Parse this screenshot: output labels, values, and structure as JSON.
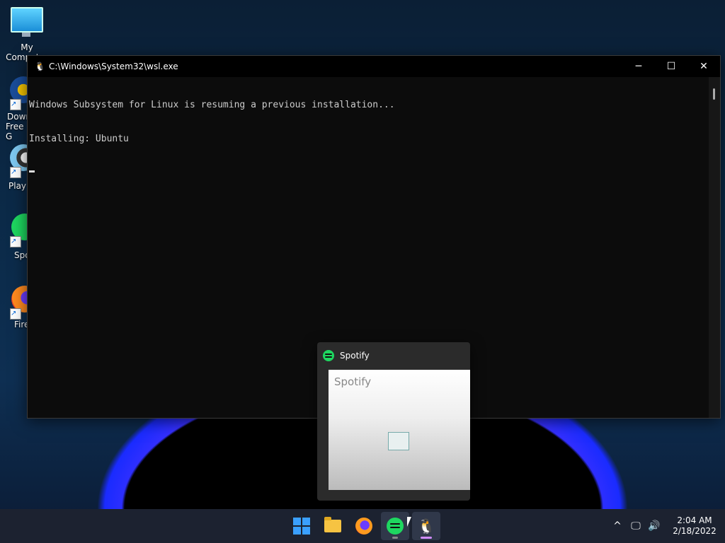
{
  "desktop": {
    "icons": [
      {
        "label": "My Computer",
        "icon": "my-computer-icon"
      },
      {
        "label": "Dowr",
        "label2": "Free G",
        "icon": "download-icon"
      },
      {
        "label": "Play",
        "icon": "player-icon"
      },
      {
        "label": "Spo",
        "icon": "spotify-icon"
      },
      {
        "label": "Fire",
        "icon": "firefox-icon"
      }
    ]
  },
  "window": {
    "title": "C:\\Windows\\System32\\wsl.exe",
    "controls": {
      "minimize": "─",
      "maximize": "☐",
      "close": "✕"
    },
    "console_lines": [
      "Windows Subsystem for Linux is resuming a previous installation...",
      "Installing: Ubuntu"
    ]
  },
  "preview": {
    "app_name": "Spotify",
    "thumbnail_title": "Spotify"
  },
  "taskbar": {
    "apps": [
      "start-button",
      "file-explorer",
      "firefox",
      "spotify",
      "wsl"
    ],
    "tray": {
      "chevron": "^",
      "network": "🖵",
      "volume": "🔊"
    },
    "clock": {
      "time": "2:04 AM",
      "date": "2/18/2022"
    }
  },
  "colors": {
    "taskbar": "#1c2230",
    "console_bg": "#0c0c0c",
    "spotify": "#1ed760",
    "accent": "#3aa0ff"
  }
}
